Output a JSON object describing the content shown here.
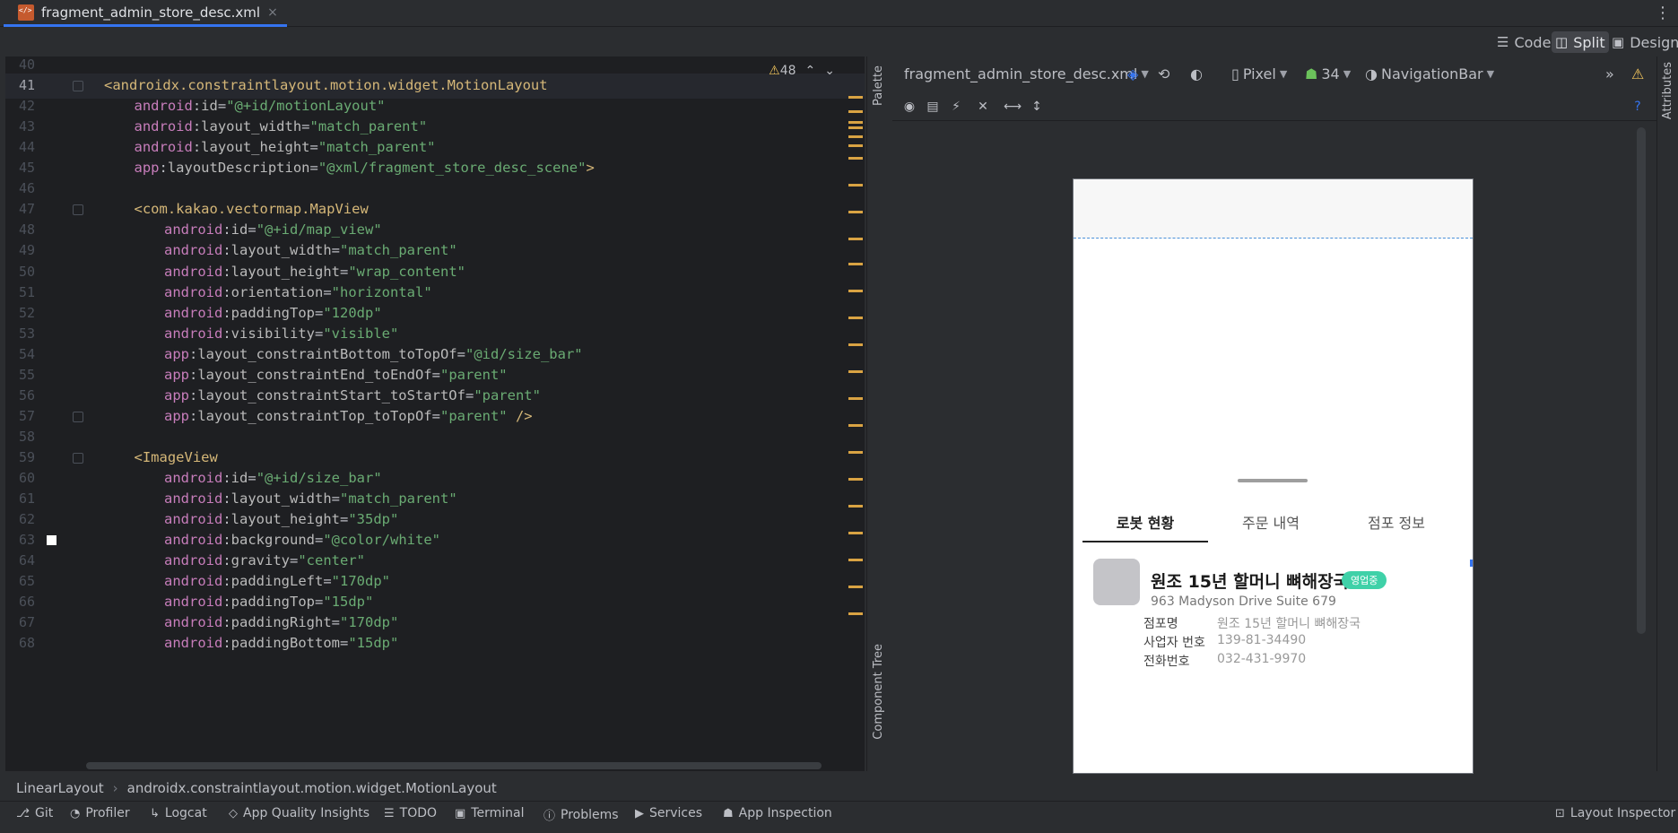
{
  "tab": {
    "filename": "fragment_admin_store_desc.xml",
    "close": "×",
    "more": "⋮"
  },
  "modes": {
    "code": "Code",
    "split": "Split",
    "design": "Design"
  },
  "editor": {
    "warnings": "48",
    "lines": [
      {
        "n": "40",
        "parts": []
      },
      {
        "n": "41",
        "parts": [
          [
            "br",
            "<"
          ],
          [
            "tag",
            "androidx.constraintlayout.motion.widget.MotionLayout"
          ]
        ]
      },
      {
        "n": "42",
        "parts": [
          [
            "ns",
            "android"
          ],
          [
            "plain",
            ":"
          ],
          [
            "attr",
            "id"
          ],
          [
            "plain",
            "="
          ],
          [
            "val",
            "\"@+id/motionLayout\""
          ]
        ]
      },
      {
        "n": "43",
        "parts": [
          [
            "ns",
            "android"
          ],
          [
            "plain",
            ":"
          ],
          [
            "attr",
            "layout_width"
          ],
          [
            "plain",
            "="
          ],
          [
            "val",
            "\"match_parent\""
          ]
        ]
      },
      {
        "n": "44",
        "parts": [
          [
            "ns",
            "android"
          ],
          [
            "plain",
            ":"
          ],
          [
            "attr",
            "layout_height"
          ],
          [
            "plain",
            "="
          ],
          [
            "val",
            "\"match_parent\""
          ]
        ]
      },
      {
        "n": "45",
        "parts": [
          [
            "ns",
            "app"
          ],
          [
            "plain",
            ":"
          ],
          [
            "attr",
            "layoutDescription"
          ],
          [
            "plain",
            "="
          ],
          [
            "val",
            "\"@xml/fragment_store_desc_scene\""
          ],
          [
            "br",
            ">"
          ]
        ]
      },
      {
        "n": "46",
        "parts": []
      },
      {
        "n": "47",
        "parts": [
          [
            "br",
            "<"
          ],
          [
            "tag",
            "com.kakao.vectormap.MapView"
          ]
        ]
      },
      {
        "n": "48",
        "parts": [
          [
            "ns",
            "android"
          ],
          [
            "plain",
            ":"
          ],
          [
            "attr",
            "id"
          ],
          [
            "plain",
            "="
          ],
          [
            "val",
            "\"@+id/map_view\""
          ]
        ]
      },
      {
        "n": "49",
        "parts": [
          [
            "ns",
            "android"
          ],
          [
            "plain",
            ":"
          ],
          [
            "attr",
            "layout_width"
          ],
          [
            "plain",
            "="
          ],
          [
            "val",
            "\"match_parent\""
          ]
        ]
      },
      {
        "n": "50",
        "parts": [
          [
            "ns",
            "android"
          ],
          [
            "plain",
            ":"
          ],
          [
            "attr",
            "layout_height"
          ],
          [
            "plain",
            "="
          ],
          [
            "val",
            "\"wrap_content\""
          ]
        ]
      },
      {
        "n": "51",
        "parts": [
          [
            "ns",
            "android"
          ],
          [
            "plain",
            ":"
          ],
          [
            "attr",
            "orientation"
          ],
          [
            "plain",
            "="
          ],
          [
            "val",
            "\"horizontal\""
          ]
        ]
      },
      {
        "n": "52",
        "parts": [
          [
            "ns",
            "android"
          ],
          [
            "plain",
            ":"
          ],
          [
            "attr",
            "paddingTop"
          ],
          [
            "plain",
            "="
          ],
          [
            "val",
            "\"120dp\""
          ]
        ]
      },
      {
        "n": "53",
        "parts": [
          [
            "ns",
            "android"
          ],
          [
            "plain",
            ":"
          ],
          [
            "attr",
            "visibility"
          ],
          [
            "plain",
            "="
          ],
          [
            "val",
            "\"visible\""
          ]
        ]
      },
      {
        "n": "54",
        "parts": [
          [
            "ns",
            "app"
          ],
          [
            "plain",
            ":"
          ],
          [
            "attr",
            "layout_constraintBottom_toTopOf"
          ],
          [
            "plain",
            "="
          ],
          [
            "val",
            "\"@id/size_bar\""
          ]
        ]
      },
      {
        "n": "55",
        "parts": [
          [
            "ns",
            "app"
          ],
          [
            "plain",
            ":"
          ],
          [
            "attr",
            "layout_constraintEnd_toEndOf"
          ],
          [
            "plain",
            "="
          ],
          [
            "val",
            "\"parent\""
          ]
        ]
      },
      {
        "n": "56",
        "parts": [
          [
            "ns",
            "app"
          ],
          [
            "plain",
            ":"
          ],
          [
            "attr",
            "layout_constraintStart_toStartOf"
          ],
          [
            "plain",
            "="
          ],
          [
            "val",
            "\"parent\""
          ]
        ]
      },
      {
        "n": "57",
        "parts": [
          [
            "ns",
            "app"
          ],
          [
            "plain",
            ":"
          ],
          [
            "attr",
            "layout_constraintTop_toTopOf"
          ],
          [
            "plain",
            "="
          ],
          [
            "val",
            "\"parent\""
          ],
          [
            "br",
            " />"
          ]
        ]
      },
      {
        "n": "58",
        "parts": []
      },
      {
        "n": "59",
        "parts": [
          [
            "br",
            "<"
          ],
          [
            "tag",
            "ImageView"
          ]
        ]
      },
      {
        "n": "60",
        "parts": [
          [
            "ns",
            "android"
          ],
          [
            "plain",
            ":"
          ],
          [
            "attr",
            "id"
          ],
          [
            "plain",
            "="
          ],
          [
            "val",
            "\"@+id/size_bar\""
          ]
        ]
      },
      {
        "n": "61",
        "parts": [
          [
            "ns",
            "android"
          ],
          [
            "plain",
            ":"
          ],
          [
            "attr",
            "layout_width"
          ],
          [
            "plain",
            "="
          ],
          [
            "val",
            "\"match_parent\""
          ]
        ]
      },
      {
        "n": "62",
        "parts": [
          [
            "ns",
            "android"
          ],
          [
            "plain",
            ":"
          ],
          [
            "attr",
            "layout_height"
          ],
          [
            "plain",
            "="
          ],
          [
            "val",
            "\"35dp\""
          ]
        ]
      },
      {
        "n": "63",
        "parts": [
          [
            "ns",
            "android"
          ],
          [
            "plain",
            ":"
          ],
          [
            "attr",
            "background"
          ],
          [
            "plain",
            "="
          ],
          [
            "val",
            "\"@color/white\""
          ]
        ]
      },
      {
        "n": "64",
        "parts": [
          [
            "ns",
            "android"
          ],
          [
            "plain",
            ":"
          ],
          [
            "attr",
            "gravity"
          ],
          [
            "plain",
            "="
          ],
          [
            "val",
            "\"center\""
          ]
        ]
      },
      {
        "n": "65",
        "parts": [
          [
            "ns",
            "android"
          ],
          [
            "plain",
            ":"
          ],
          [
            "attr",
            "paddingLeft"
          ],
          [
            "plain",
            "="
          ],
          [
            "val",
            "\"170dp\""
          ]
        ]
      },
      {
        "n": "66",
        "parts": [
          [
            "ns",
            "android"
          ],
          [
            "plain",
            ":"
          ],
          [
            "attr",
            "paddingTop"
          ],
          [
            "plain",
            "="
          ],
          [
            "val",
            "\"15dp\""
          ]
        ]
      },
      {
        "n": "67",
        "parts": [
          [
            "ns",
            "android"
          ],
          [
            "plain",
            ":"
          ],
          [
            "attr",
            "paddingRight"
          ],
          [
            "plain",
            "="
          ],
          [
            "val",
            "\"170dp\""
          ]
        ]
      },
      {
        "n": "68",
        "parts": [
          [
            "ns",
            "android"
          ],
          [
            "plain",
            ":"
          ],
          [
            "attr",
            "paddingBottom"
          ],
          [
            "plain",
            "="
          ],
          [
            "val",
            "\"15dp\""
          ]
        ]
      }
    ]
  },
  "side_panels": {
    "palette": "Palette",
    "component_tree": "Component Tree",
    "attributes": "Attributes"
  },
  "design_toolbar": {
    "file": "fragment_admin_store_desc.xml",
    "device": "Pixel",
    "api": "34",
    "theme": "NavigationBar"
  },
  "preview": {
    "tabs": [
      "로봇 현황",
      "주문 내역",
      "점포 정보"
    ],
    "store_name": "원조 15년 할머니 뼈해장국",
    "badge": "영업중",
    "address": "963 Madyson Drive Suite 679",
    "info": [
      {
        "label": "점포명",
        "value": "원조 15년 할머니 뼈해장국"
      },
      {
        "label": "사업자 번호",
        "value": "139-81-34490"
      },
      {
        "label": "전화번호",
        "value": "032-431-9970"
      }
    ]
  },
  "breadcrumb": [
    "LinearLayout",
    "androidx.constraintlayout.motion.widget.MotionLayout"
  ],
  "tool_windows": [
    "Git",
    "Profiler",
    "Logcat",
    "App Quality Insights",
    "TODO",
    "Terminal",
    "Problems",
    "Services",
    "App Inspection"
  ],
  "layout_inspector": "Layout Inspector"
}
